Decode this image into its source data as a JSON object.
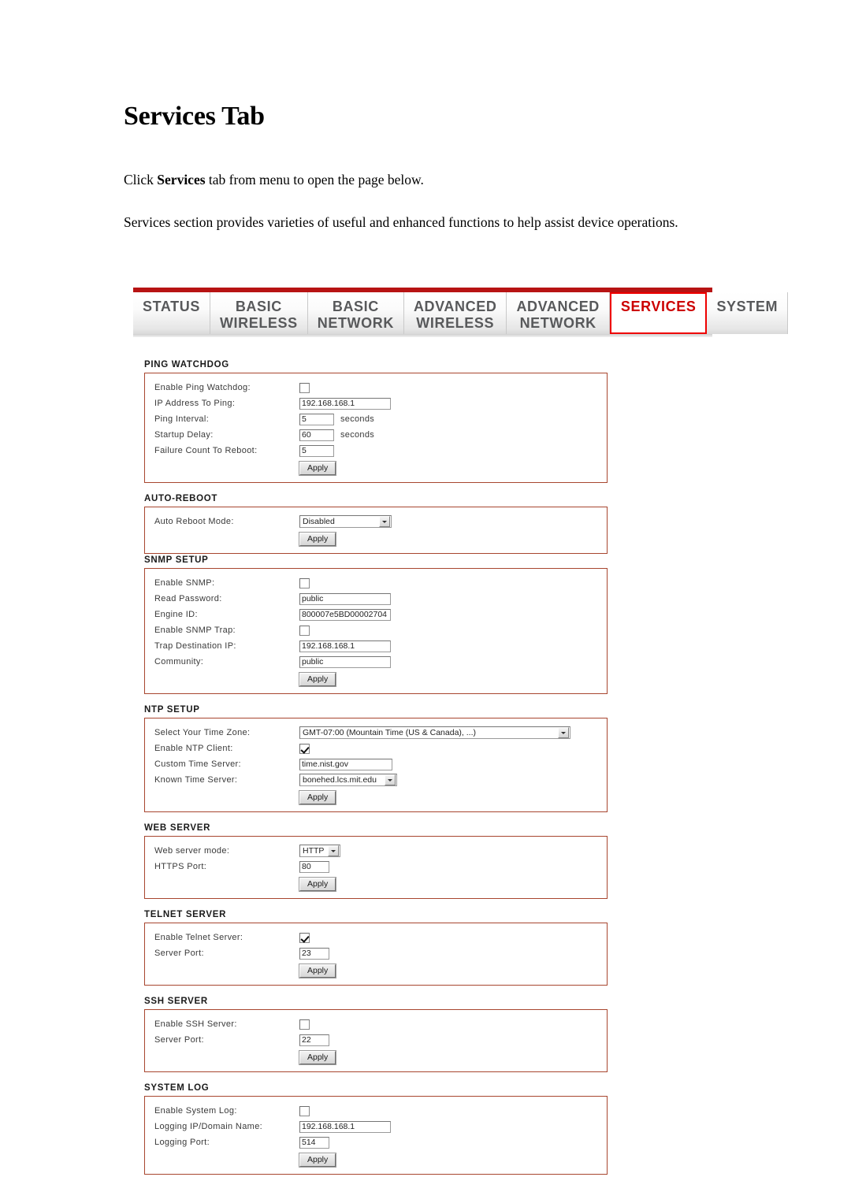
{
  "document": {
    "title": "Services Tab",
    "paragraph_1_prefix": "Click ",
    "paragraph_1_bold": "Services",
    "paragraph_1_suffix": " tab from menu to open the page below.",
    "paragraph_2": "Services section provides varieties of useful and enhanced functions to help assist device operations."
  },
  "colors": {
    "accent_red": "#b71313",
    "active_tab_border": "#ee0000",
    "active_tab_text": "#cc0000",
    "section_border": "#a8462f",
    "label_text": "#3a3a3a"
  },
  "nav": {
    "tabs": [
      {
        "line1": "STATUS",
        "line2": "",
        "active": false
      },
      {
        "line1": "BASIC",
        "line2": "WIRELESS",
        "active": false
      },
      {
        "line1": "BASIC",
        "line2": "NETWORK",
        "active": false
      },
      {
        "line1": "ADVANCED",
        "line2": "WIRELESS",
        "active": false
      },
      {
        "line1": "ADVANCED",
        "line2": "NETWORK",
        "active": false
      },
      {
        "line1": "SERVICES",
        "line2": "",
        "active": true
      },
      {
        "line1": "SYSTEM",
        "line2": "",
        "active": false
      }
    ]
  },
  "apply_label": "Apply",
  "sections": {
    "ping_watchdog": {
      "title": "PING WATCHDOG",
      "enable_label": "Enable Ping Watchdog:",
      "enable_checked": false,
      "ip_label": "IP Address To Ping:",
      "ip_value": "192.168.168.1",
      "interval_label": "Ping Interval:",
      "interval_value": "5",
      "interval_unit": "seconds",
      "startup_label": "Startup Delay:",
      "startup_value": "60",
      "startup_unit": "seconds",
      "failure_label": "Failure Count To Reboot:",
      "failure_value": "5"
    },
    "auto_reboot": {
      "title": "AUTO-REBOOT",
      "mode_label": "Auto Reboot Mode:",
      "mode_value": "Disabled"
    },
    "snmp_setup": {
      "title": "SNMP SETUP",
      "enable_label": "Enable SNMP:",
      "enable_checked": false,
      "read_password_label": "Read Password:",
      "read_password_value": "public",
      "engine_id_label": "Engine ID:",
      "engine_id_value": "800007e5BD00002704",
      "enable_trap_label": "Enable SNMP Trap:",
      "enable_trap_checked": false,
      "trap_ip_label": "Trap Destination IP:",
      "trap_ip_value": "192.168.168.1",
      "community_label": "Community:",
      "community_value": "public"
    },
    "ntp_setup": {
      "title": "NTP SETUP",
      "timezone_label": "Select Your Time Zone:",
      "timezone_value": "GMT-07:00 (Mountain Time (US & Canada), ...)",
      "enable_label": "Enable NTP Client:",
      "enable_checked": true,
      "custom_server_label": "Custom Time Server:",
      "custom_server_value": "time.nist.gov",
      "known_server_label": "Known Time Server:",
      "known_server_value": "bonehed.lcs.mit.edu"
    },
    "web_server": {
      "title": "WEB SERVER",
      "mode_label": "Web server mode:",
      "mode_value": "HTTP",
      "port_label": "HTTPS Port:",
      "port_value": "80"
    },
    "telnet_server": {
      "title": "TELNET SERVER",
      "enable_label": "Enable Telnet Server:",
      "enable_checked": true,
      "port_label": "Server Port:",
      "port_value": "23"
    },
    "ssh_server": {
      "title": "SSH SERVER",
      "enable_label": "Enable SSH Server:",
      "enable_checked": false,
      "port_label": "Server Port:",
      "port_value": "22"
    },
    "system_log": {
      "title": "SYSTEM LOG",
      "enable_label": "Enable System Log:",
      "enable_checked": false,
      "ip_label": "Logging IP/Domain Name:",
      "ip_value": "192.168.168.1",
      "port_label": "Logging Port:",
      "port_value": "514"
    }
  }
}
